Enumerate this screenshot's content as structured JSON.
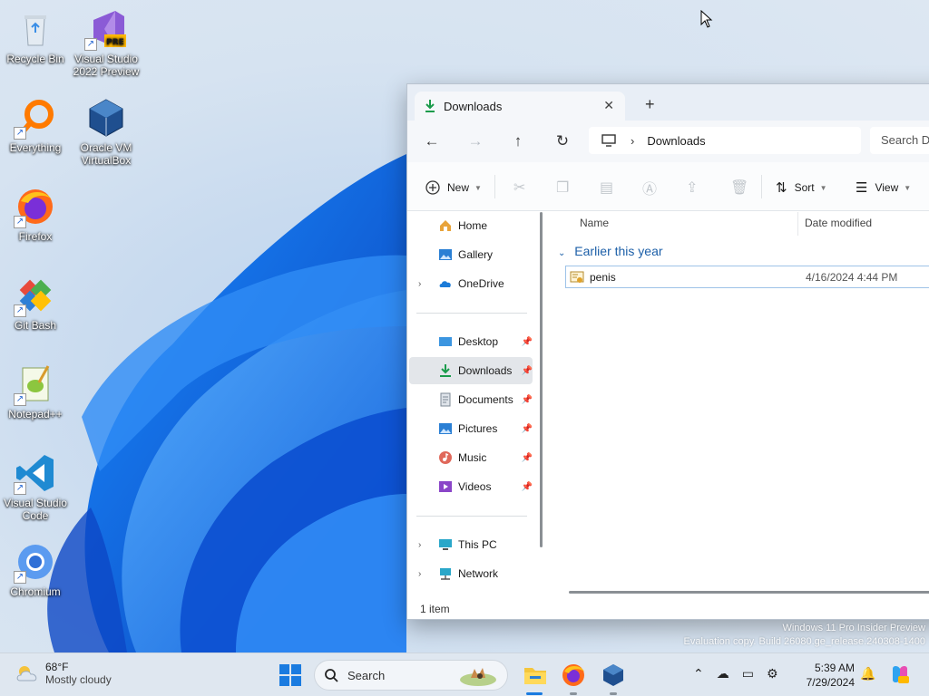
{
  "desktop": {
    "icons": [
      {
        "label_1": "Recycle Bin",
        "label_2": ""
      },
      {
        "label_1": "Visual Studio",
        "label_2": "2022 Preview"
      },
      {
        "label_1": "Everything",
        "label_2": ""
      },
      {
        "label_1": "Oracle VM",
        "label_2": "VirtualBox"
      },
      {
        "label_1": "Firefox",
        "label_2": ""
      },
      {
        "label_1": "Git Bash",
        "label_2": ""
      },
      {
        "label_1": "Notepad++",
        "label_2": ""
      },
      {
        "label_1": "Visual Studio",
        "label_2": "Code"
      },
      {
        "label_1": "Chromium",
        "label_2": ""
      }
    ],
    "pre_badge": "PRE",
    "watermark_line1": "Windows 11 Pro Insider Preview",
    "watermark_line2": "Evaluation copy. Build 26080.ge_release.240308-1400"
  },
  "explorer": {
    "tab_title": "Downloads",
    "tab_close": "✕",
    "new_tab": "+",
    "nav": {
      "back": "←",
      "forward": "→",
      "up": "↑",
      "refresh": "↻"
    },
    "address_path": "Downloads",
    "address_chevron": "›",
    "search_placeholder": "Search Downloads",
    "toolbar": {
      "new_label": "New",
      "sort_label": "Sort",
      "view_label": "View"
    },
    "sidebar": {
      "home": "Home",
      "gallery": "Gallery",
      "onedrive": "OneDrive",
      "desktop": "Desktop",
      "downloads": "Downloads",
      "documents": "Documents",
      "pictures": "Pictures",
      "music": "Music",
      "videos": "Videos",
      "this_pc": "This PC",
      "network": "Network"
    },
    "columns": {
      "name": "Name",
      "date_modified": "Date modified"
    },
    "group_header": "Earlier this year",
    "files": [
      {
        "name": "penis",
        "date": "4/16/2024 4:44 PM"
      }
    ],
    "status": "1 item"
  },
  "taskbar": {
    "weather_temp": "68°F",
    "weather_desc": "Mostly cloudy",
    "search_label": "Search",
    "time": "5:39 AM",
    "date": "7/29/2024"
  },
  "colors": {
    "accent": "#1a7be0",
    "group_header": "#1c5fa8"
  }
}
